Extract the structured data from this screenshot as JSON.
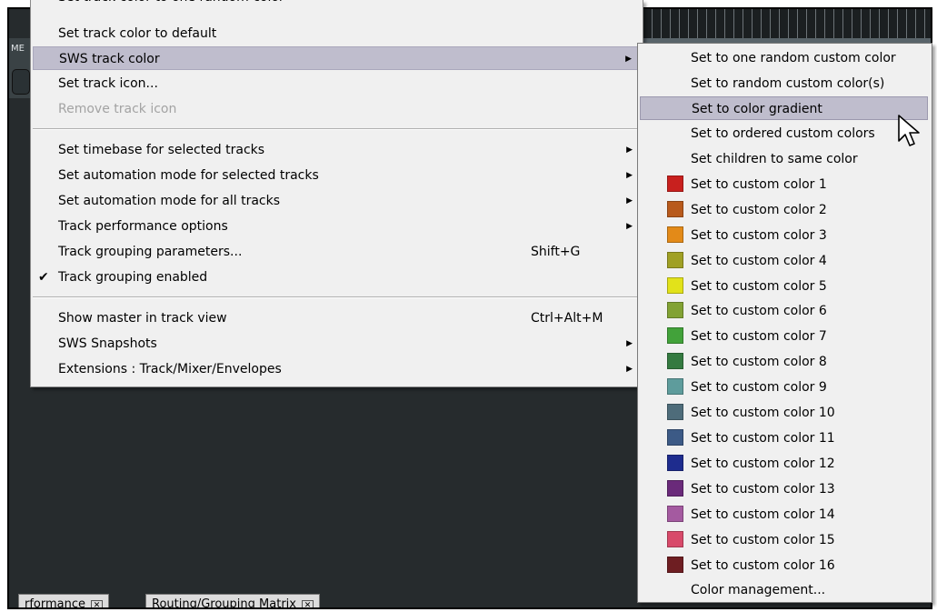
{
  "main_menu": {
    "partial_top_item": "Set track color to one random color",
    "items": [
      {
        "label": "Set track color to default"
      },
      {
        "label": "SWS track color",
        "submenu": true,
        "highlighted": true
      },
      {
        "label": "Set track icon..."
      },
      {
        "label": "Remove track icon",
        "disabled": true
      },
      {
        "label": "Set timebase for selected tracks",
        "submenu": true
      },
      {
        "label": "Set automation mode for selected tracks",
        "submenu": true
      },
      {
        "label": "Set automation mode for all tracks",
        "submenu": true
      },
      {
        "label": "Track performance options",
        "submenu": true
      },
      {
        "label": "Track grouping parameters...",
        "shortcut": "Shift+G"
      },
      {
        "label": "Track grouping enabled",
        "checked": true
      },
      {
        "label": "Show master in track view",
        "shortcut": "Ctrl+Alt+M"
      },
      {
        "label": "SWS Snapshots",
        "submenu": true
      },
      {
        "label": "Extensions : Track/Mixer/Envelopes",
        "submenu": true
      }
    ]
  },
  "submenu": {
    "items": [
      {
        "label": "Set to one random custom color"
      },
      {
        "label": "Set to random custom color(s)"
      },
      {
        "label": "Set to color gradient",
        "highlighted": true
      },
      {
        "label": "Set to ordered custom colors"
      },
      {
        "label": "Set children to same color"
      },
      {
        "label": "Set to custom color 1",
        "color": "#c8201e"
      },
      {
        "label": "Set to custom color 2",
        "color": "#b85a1c"
      },
      {
        "label": "Set to custom color 3",
        "color": "#e38a18"
      },
      {
        "label": "Set to custom color 4",
        "color": "#a0a024"
      },
      {
        "label": "Set to custom color 5",
        "color": "#e2e21a"
      },
      {
        "label": "Set to custom color 6",
        "color": "#82a233"
      },
      {
        "label": "Set to custom color 7",
        "color": "#42a23a"
      },
      {
        "label": "Set to custom color 8",
        "color": "#347a40"
      },
      {
        "label": "Set to custom color 9",
        "color": "#5e9c9c"
      },
      {
        "label": "Set to custom color 10",
        "color": "#4e6c7a"
      },
      {
        "label": "Set to custom color 11",
        "color": "#3c5a86"
      },
      {
        "label": "Set to custom color 12",
        "color": "#1e2c8e"
      },
      {
        "label": "Set to custom color 13",
        "color": "#6a2a7a"
      },
      {
        "label": "Set to custom color 14",
        "color": "#a45aa0"
      },
      {
        "label": "Set to custom color 15",
        "color": "#d84a6a"
      },
      {
        "label": "Set to custom color 16",
        "color": "#6e1e22"
      },
      {
        "label": "Color management..."
      }
    ]
  },
  "background": {
    "side_label": "ME"
  },
  "bottom_tabs": [
    {
      "label": "rformance"
    },
    {
      "label": "Routing/Grouping Matrix"
    }
  ]
}
